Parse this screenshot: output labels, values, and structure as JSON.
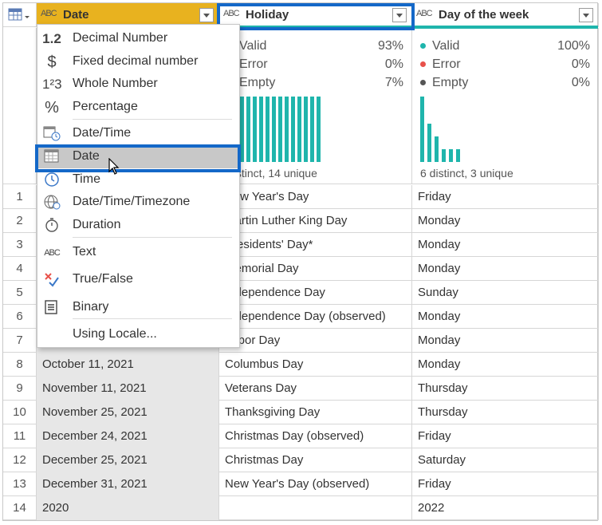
{
  "columns": {
    "date": {
      "type_icon": "ABC",
      "name": "Date"
    },
    "holiday": {
      "type_icon": "ABC",
      "name": "Holiday"
    },
    "dow": {
      "type_icon": "ABC",
      "name": "Day of the week"
    }
  },
  "profile": {
    "holiday": {
      "valid_label": "Valid",
      "valid_pct": "93%",
      "error_label": "Error",
      "error_pct": "0%",
      "empty_label": "Empty",
      "empty_pct": "7%",
      "distinct": "distinct, 14 unique"
    },
    "dow": {
      "valid_label": "Valid",
      "valid_pct": "100%",
      "error_label": "Error",
      "error_pct": "0%",
      "empty_label": "Empty",
      "empty_pct": "0%",
      "distinct": "6 distinct, 3 unique"
    },
    "colors": {
      "valid": "#1fb5ac",
      "error": "#e8514a",
      "empty": "#555555"
    }
  },
  "menu": {
    "items": [
      {
        "icon": "1.2",
        "label": "Decimal Number"
      },
      {
        "icon": "$",
        "label": "Fixed decimal number"
      },
      {
        "icon": "1²3",
        "label": "Whole Number"
      },
      {
        "icon": "%",
        "label": "Percentage"
      },
      {
        "icon": "datetime-icon",
        "label": "Date/Time"
      },
      {
        "icon": "calendar-icon",
        "label": "Date"
      },
      {
        "icon": "clock-icon",
        "label": "Time"
      },
      {
        "icon": "globe-icon",
        "label": "Date/Time/Timezone"
      },
      {
        "icon": "stopwatch-icon",
        "label": "Duration"
      },
      {
        "icon": "ABC",
        "label": "Text"
      },
      {
        "icon": "true-false-icon",
        "label": "True/False"
      },
      {
        "icon": "binary-icon",
        "label": "Binary"
      },
      {
        "icon": "",
        "label": "Using Locale..."
      }
    ],
    "selected": "Date"
  },
  "rows": [
    {
      "n": "1",
      "date": "",
      "holiday": "New Year's Day",
      "dow": "Friday"
    },
    {
      "n": "2",
      "date": "",
      "holiday": "Martin Luther King Day",
      "dow": "Monday"
    },
    {
      "n": "3",
      "date": "",
      "holiday": "Presidents' Day*",
      "dow": "Monday"
    },
    {
      "n": "4",
      "date": "",
      "holiday": "Memorial Day",
      "dow": "Monday"
    },
    {
      "n": "5",
      "date": "",
      "holiday": "Independence Day",
      "dow": "Sunday"
    },
    {
      "n": "6",
      "date": "",
      "holiday": "Independence Day (observed)",
      "dow": "Monday"
    },
    {
      "n": "7",
      "date": "",
      "holiday": "Labor Day",
      "dow": "Monday"
    },
    {
      "n": "8",
      "date": "October 11, 2021",
      "holiday": "Columbus Day",
      "dow": "Monday"
    },
    {
      "n": "9",
      "date": "November 11, 2021",
      "holiday": "Veterans Day",
      "dow": "Thursday"
    },
    {
      "n": "10",
      "date": "November 25, 2021",
      "holiday": "Thanksgiving Day",
      "dow": "Thursday"
    },
    {
      "n": "11",
      "date": "December 24, 2021",
      "holiday": "Christmas Day (observed)",
      "dow": "Friday"
    },
    {
      "n": "12",
      "date": "December 25, 2021",
      "holiday": "Christmas Day",
      "dow": "Saturday"
    },
    {
      "n": "13",
      "date": "December 31, 2021",
      "holiday": "New Year's Day (observed)",
      "dow": "Friday"
    },
    {
      "n": "14",
      "date": "2020",
      "holiday": "",
      "dow": "2022"
    }
  ]
}
